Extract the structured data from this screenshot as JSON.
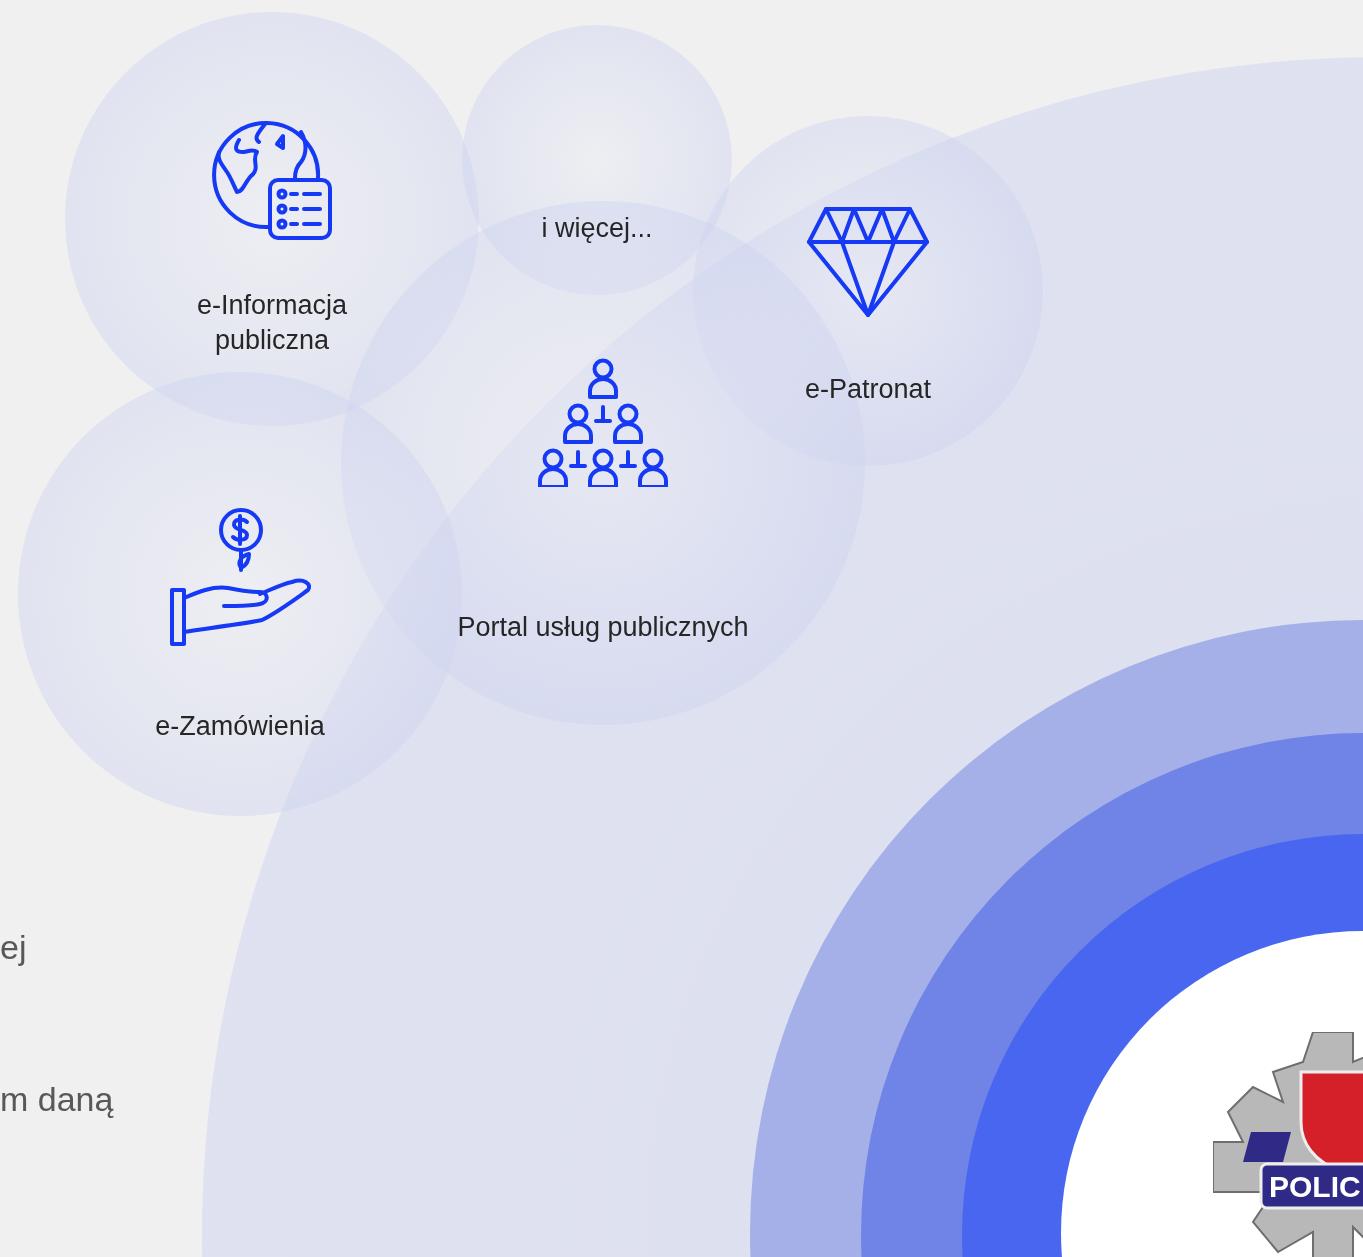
{
  "bubbles": [
    {
      "label": "e-Informacja publiczna"
    },
    {
      "label": "i więcej..."
    },
    {
      "label": "e-Patronat"
    },
    {
      "label": "Portal usług publicznych"
    },
    {
      "label": "e-Zamówienia"
    }
  ],
  "side_texts": [
    "ej",
    "m daną"
  ],
  "logo": {
    "text": "POLIC"
  }
}
